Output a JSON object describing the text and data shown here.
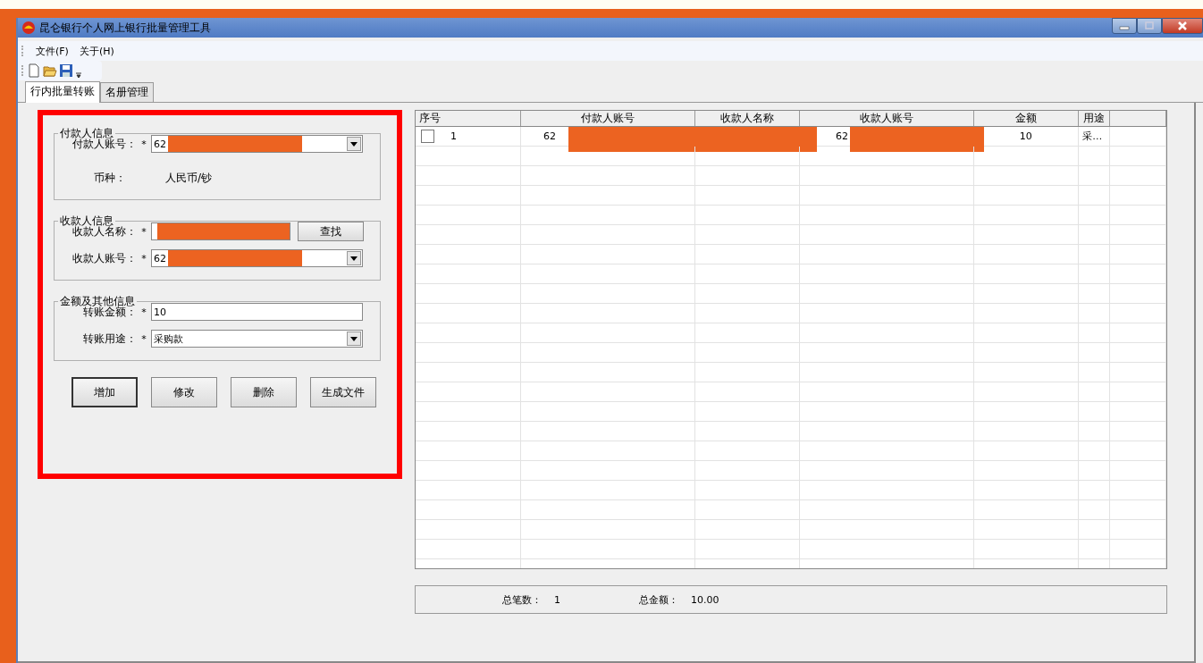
{
  "window": {
    "title": "昆仑银行个人网上银行批量管理工具"
  },
  "menu": [
    "文件(F)",
    "关于(H)"
  ],
  "tabs": [
    {
      "label": "行内批量转账",
      "selected": true
    },
    {
      "label": "名册管理",
      "selected": false
    }
  ],
  "form": {
    "groups": [
      {
        "title": "付款人信息",
        "fields": [
          {
            "kind": "combo",
            "label": "付款人账号：",
            "required_mark": "*",
            "value": "62",
            "redacted": true
          },
          {
            "kind": "static",
            "label": "币种：",
            "value": "人民币/钞"
          }
        ]
      },
      {
        "title": "收款人信息",
        "fields": [
          {
            "kind": "search",
            "label": "收款人名称：",
            "required_mark": "*",
            "button": "查找",
            "redacted": true
          },
          {
            "kind": "combo",
            "label": "收款人账号：",
            "required_mark": "*",
            "value": "62",
            "redacted": true
          }
        ]
      },
      {
        "title": "金额及其他信息",
        "fields": [
          {
            "kind": "text",
            "label": "转账金额：",
            "required_mark": "*",
            "value": "10"
          },
          {
            "kind": "combo",
            "label": "转账用途：",
            "required_mark": "*",
            "value": "采购款"
          }
        ]
      }
    ],
    "buttons": [
      {
        "label": "增加",
        "default": true
      },
      {
        "label": "修改",
        "default": false
      },
      {
        "label": "删除",
        "default": false
      },
      {
        "label": "生成文件",
        "default": false
      }
    ]
  },
  "table": {
    "columns": [
      "序号",
      "付款人账号",
      "收款人名称",
      "收款人账号",
      "金额",
      "用途"
    ],
    "rows": [
      {
        "checked": false,
        "index": "1",
        "payer_account": "62",
        "payee_account": "62",
        "amount": "10",
        "purpose": "采…",
        "redacted": true
      }
    ]
  },
  "summary": [
    {
      "label": "总笔数：",
      "value": "1"
    },
    {
      "label": "总金额：",
      "value": "10.00"
    }
  ]
}
